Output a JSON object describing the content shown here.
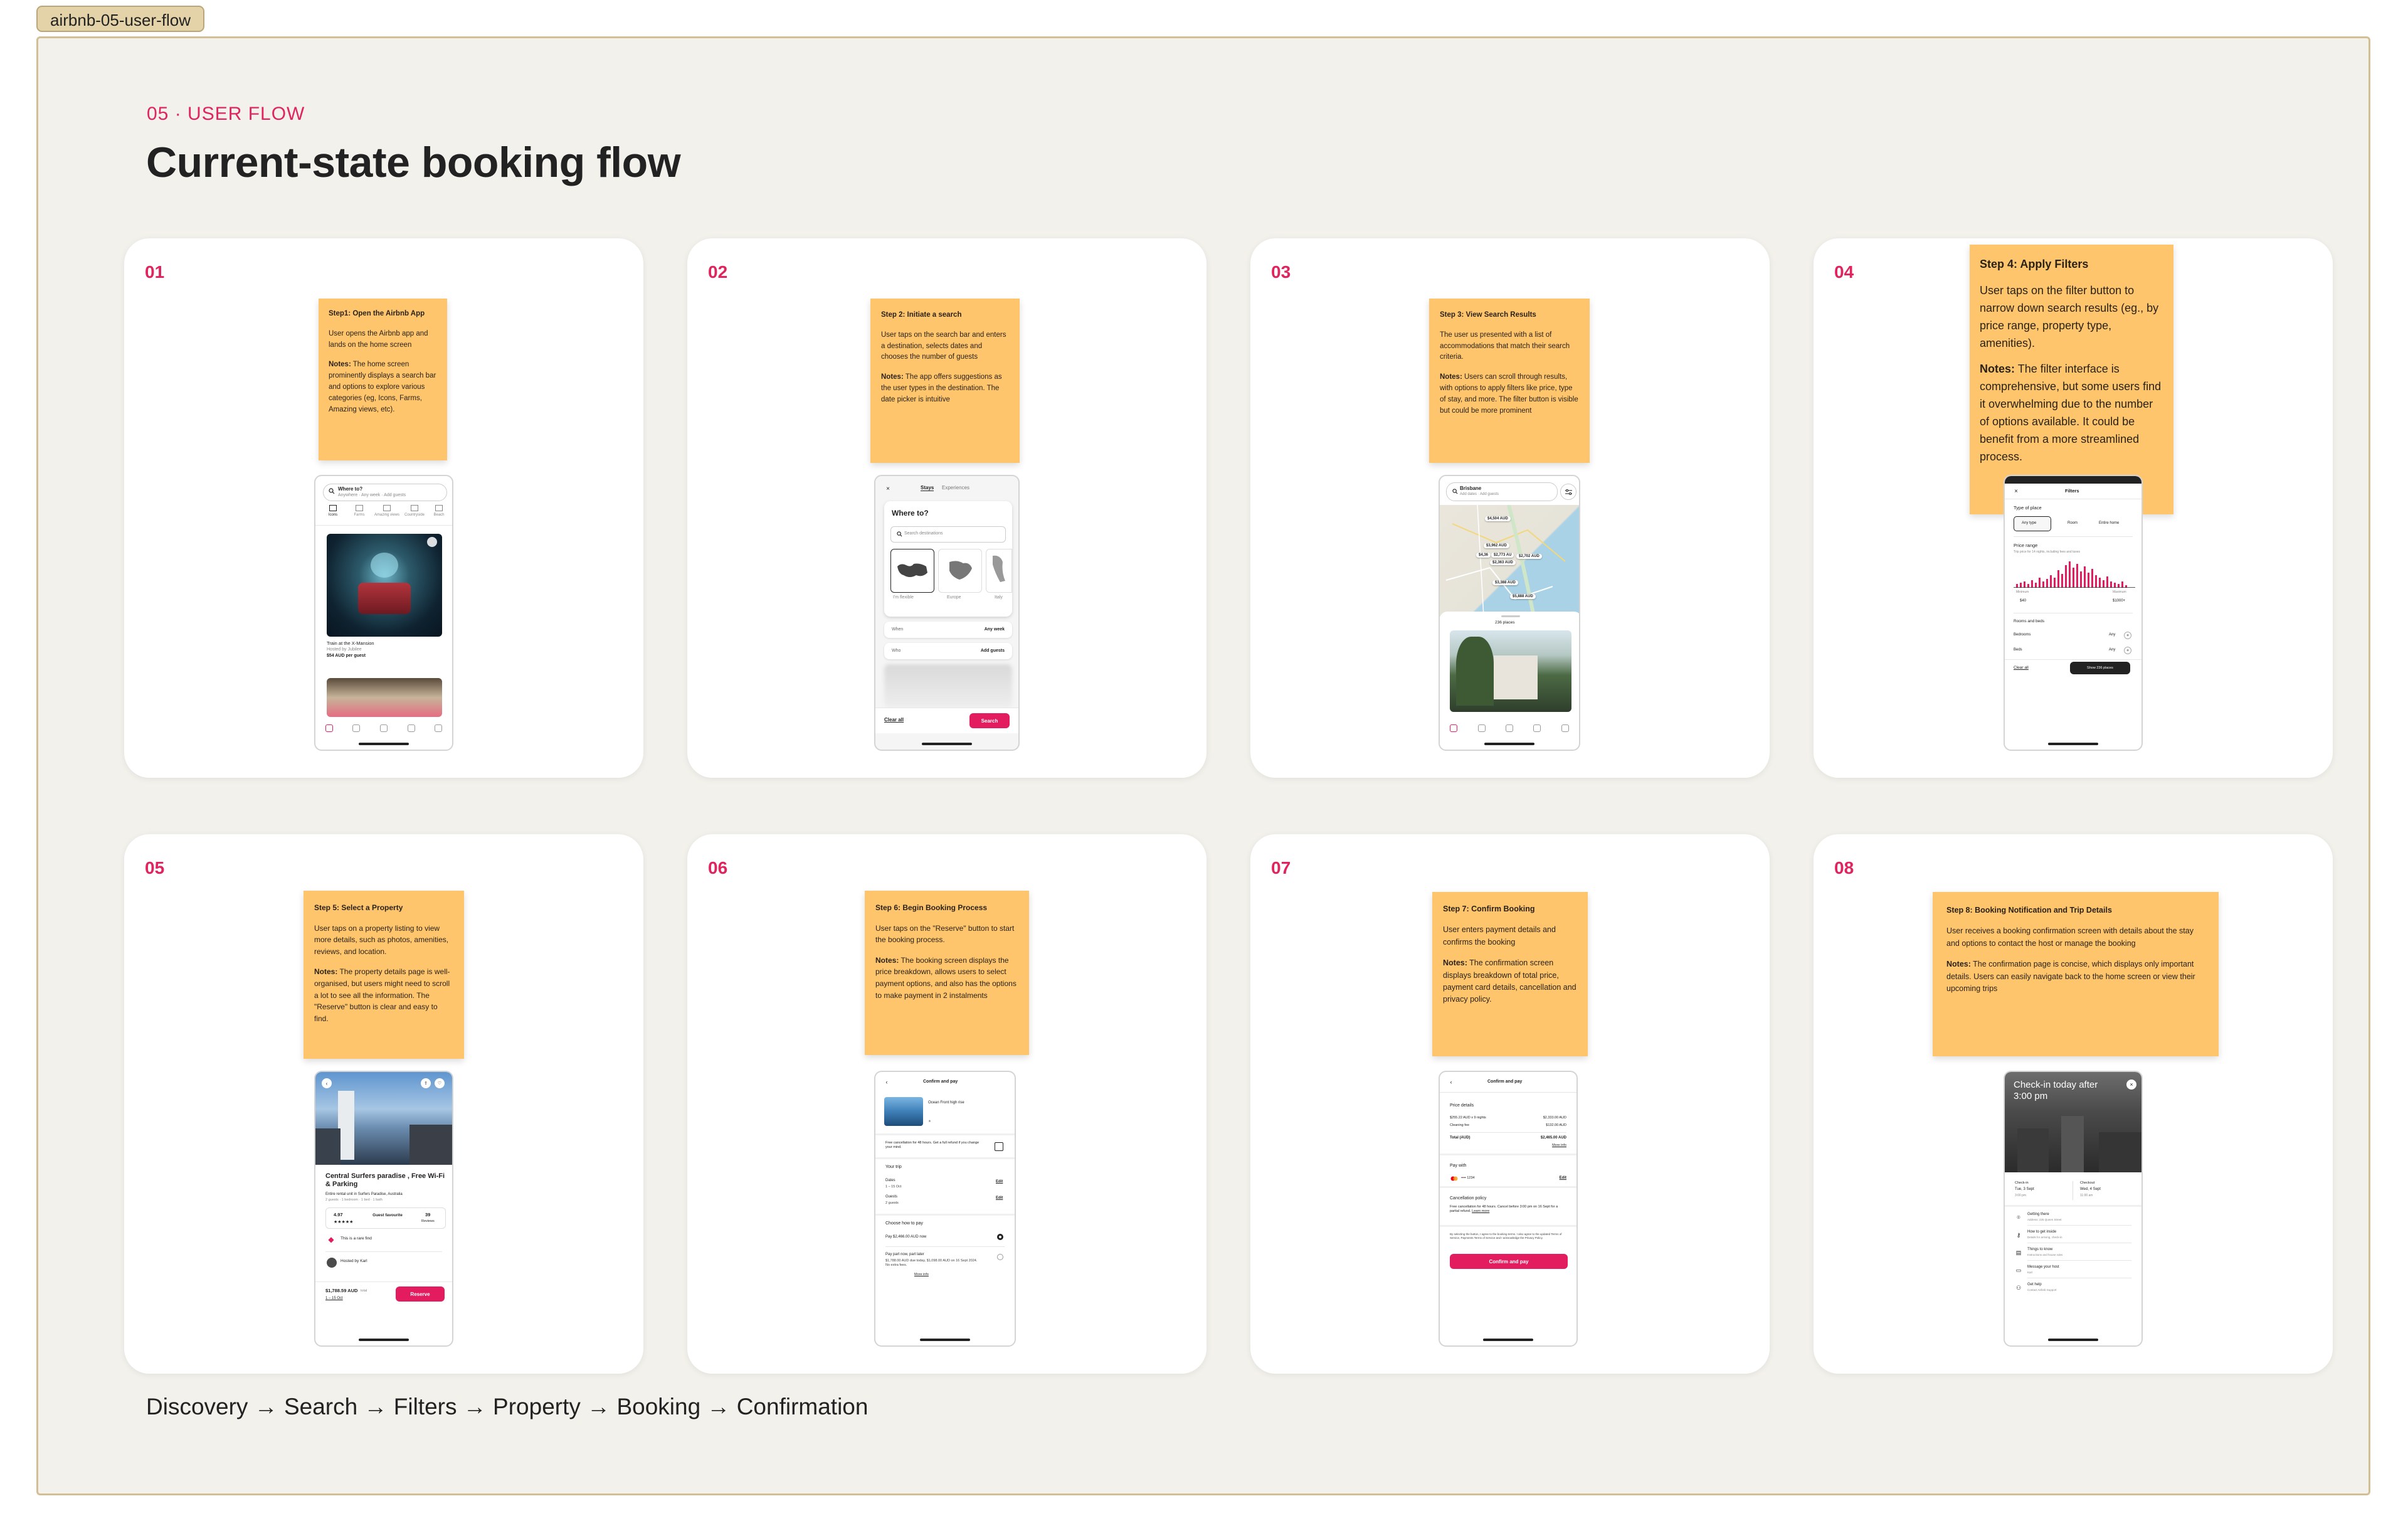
{
  "frame_label": "airbnb-05-user-flow",
  "section_label": "05 · USER FLOW",
  "title": "Current-state booking flow",
  "flow_text": "Discovery → Search → Filters → Property → Booking → Confirmation",
  "accent_color": "#e0245e",
  "sticky_color": "#fec56d",
  "cards": [
    {
      "num": "01",
      "sticky_title": "Step1: Open the Airbnb App",
      "sticky_body": "User opens the Airbnb app and lands on the home screen",
      "notes_label": "Notes:",
      "notes": "The home screen prominently displays a search bar and options to explore various categories (eg, Icons, Farms, Amazing views, etc).",
      "phone": {
        "search_label": "Where to?",
        "search_sub": "Anywhere · Any week · Add guests",
        "categories": [
          "Icons",
          "Farms",
          "Amazing views",
          "Countryside",
          "Beach"
        ],
        "listing_title": "Train at the X-Mansion",
        "listing_host": "Hosted by Jubilee",
        "listing_price": "$54 AUD per guest"
      }
    },
    {
      "num": "02",
      "sticky_title": "Step 2: Initiate a search",
      "sticky_body": "User taps on the search bar and enters a destination, selects dates and chooses the number of guests",
      "notes_label": "Notes:",
      "notes": "The app offers suggestions as the user types in the destination. The date picker is intuitive",
      "phone": {
        "tab_stays": "Stays",
        "tab_experiences": "Experiences",
        "heading": "Where to?",
        "input_placeholder": "Search destinations",
        "region_labels": [
          "I'm flexible",
          "Europe",
          "Italy"
        ],
        "when_label": "When",
        "when_value": "Any week",
        "who_label": "Who",
        "who_value": "Add guests",
        "clear_label": "Clear all",
        "search_button": "Search"
      }
    },
    {
      "num": "03",
      "sticky_title": "Step 3: View Search Results",
      "sticky_body": "The user us presented with a list of accommodations that match their search criteria.",
      "notes_label": "Notes:",
      "notes": "Users can scroll through results, with options to apply filters like price, type of stay, and more. The filter button is visible but could be more prominent",
      "phone": {
        "location": "Brisbane",
        "location_sub": "Add dates · Add guests",
        "map_prices": [
          "$4,504 AUD",
          "$3,962 AUD",
          "$4,36",
          "$2,773 AU",
          "$2,702 AUD",
          "$2,363 AUD",
          "$3,388 AUD",
          "$5,888 AUD"
        ],
        "results_count": "236 places"
      }
    },
    {
      "num": "04",
      "sticky_title": "Step 4: Apply Filters",
      "sticky_body": "User taps on the filter button to narrow down search results (eg., by price range, property type, amenities).",
      "notes_label": "Notes:",
      "notes": "The filter interface is comprehensive, but some users find it overwhelming due to the number of options available. It could be benefit from a more streamlined process.",
      "phone": {
        "header": "Filters",
        "type_heading": "Type of place",
        "type_options": [
          "Any type",
          "Room",
          "Entire home"
        ],
        "price_heading": "Price range",
        "price_sub": "Trip price for 14 nights, including fees and taxes",
        "min_label": "Minimum",
        "max_label": "Maximum",
        "min_value": "$40",
        "max_value": "$1000+",
        "rooms_heading": "Rooms and beds",
        "bedrooms_label": "Bedrooms",
        "beds_label": "Beds",
        "any_label": "Any",
        "clear_label": "Clear all",
        "show_button": "Show 236 places"
      }
    },
    {
      "num": "05",
      "sticky_title": "Step 5: Select a Property",
      "sticky_body": "User taps on a property listing to view more details, such as photos, amenities, reviews, and location.",
      "notes_label": "Notes:",
      "notes": "The property details page is well-organised, but users might need to scroll a lot to see all the information. The \"Reserve\" button is clear and easy to find.",
      "phone": {
        "listing_title": "Central Surfers paradise , Free Wi-Fi & Parking",
        "listing_sub": "Entire rental unit in Surfers Paradise, Australia",
        "listing_meta": "2 guests · 1 bedroom · 1 bed · 1 bath",
        "rating": "4.97",
        "badge": "Guest favourite",
        "reviews": "39",
        "reviews_label": "Reviews",
        "rare_find": "This is a rare find",
        "host": "Hosted by Karl",
        "price": "$1,788.59 AUD",
        "price_sub": "total",
        "dates": "1 – 15 Oct",
        "reserve_button": "Reserve"
      }
    },
    {
      "num": "06",
      "sticky_title": "Step 6: Begin Booking Process",
      "sticky_body": "User taps on the \"Reserve\" button to start the booking process.",
      "notes_label": "Notes:",
      "notes": "The booking screen displays the price breakdown, allows users to select payment options, and also has the options to make payment in 2 instalments",
      "phone": {
        "header": "Confirm and pay",
        "listing_name": "Ocean Front high rise",
        "cancel_text": "Free cancellation for 48 hours. Get a full refund if you change your mind.",
        "trip_heading": "Your trip",
        "dates_label": "Dates",
        "dates_value": "1 – 15 Oct",
        "guests_label": "Guests",
        "guests_value": "2 guests",
        "edit_label": "Edit",
        "pay_heading": "Choose how to pay",
        "pay_now": "Pay $2,466.00 AUD now",
        "pay_part": "Pay part now, part later",
        "pay_part_sub": "$1,788.00 AUD due today, $1,098.00 AUD on 16 Sept 2024. No extra fees.",
        "more_info": "More info"
      }
    },
    {
      "num": "07",
      "sticky_title": "Step 7: Confirm Booking",
      "sticky_body": "User enters payment details and confirms the booking",
      "notes_label": "Notes:",
      "notes": "The confirmation screen displays  breakdown of total price, payment card details, cancellation and privacy policy.",
      "phone": {
        "header": "Confirm and pay",
        "price_heading": "Price details",
        "line1_label": "$255.22 AUD x 9 nights",
        "line1_value": "$2,333.00 AUD",
        "line2_label": "Cleaning fee",
        "line2_value": "$132.00 AUD",
        "total_label": "Total (AUD)",
        "total_value": "$2,465.00 AUD",
        "more_info": "More info",
        "pay_heading": "Pay with",
        "card": "•••• 1234",
        "edit_label": "Edit",
        "cancel_heading": "Cancellation policy",
        "cancel_text": "Free cancellation for 48 hours. Cancel before 3:00 pm on 16 Sept for a partial refund.",
        "learn_more": "Learn more",
        "terms": "By selecting the button, I agree to the booking terms. I also agree to the updated Terms of Service, Payments Terms of Service and I acknowledge the Privacy Policy.",
        "confirm_button": "Confirm and pay"
      }
    },
    {
      "num": "08",
      "sticky_title": "Step 8: Booking Notification and Trip Details",
      "sticky_body": "User receives a booking confirmation screen with details about the stay and options to contact the host or manage the booking",
      "notes_label": "Notes:",
      "notes": "The confirmation page is concise, which displays only important details. Users can easily navigate back to the home screen or view their upcoming trips",
      "phone": {
        "hero_text": "Check-in today after 3:00 pm",
        "checkin_label": "Check-in",
        "checkin_value": "Tue, 3 Sept",
        "checkin_time": "3:00 pm",
        "checkout_label": "Checkout",
        "checkout_value": "Wed, 4 Sept",
        "checkout_time": "11:00 am",
        "items": [
          {
            "label": "Getting there",
            "sub": "Address: 225 Queen Street"
          },
          {
            "label": "How to get inside",
            "sub": "Details for arriving, check-in"
          },
          {
            "label": "Things to know",
            "sub": "Instructions and house rules"
          },
          {
            "label": "Message your host",
            "sub": "Karl"
          },
          {
            "label": "Get help",
            "sub": "Contact Airbnb Support"
          }
        ]
      }
    }
  ]
}
